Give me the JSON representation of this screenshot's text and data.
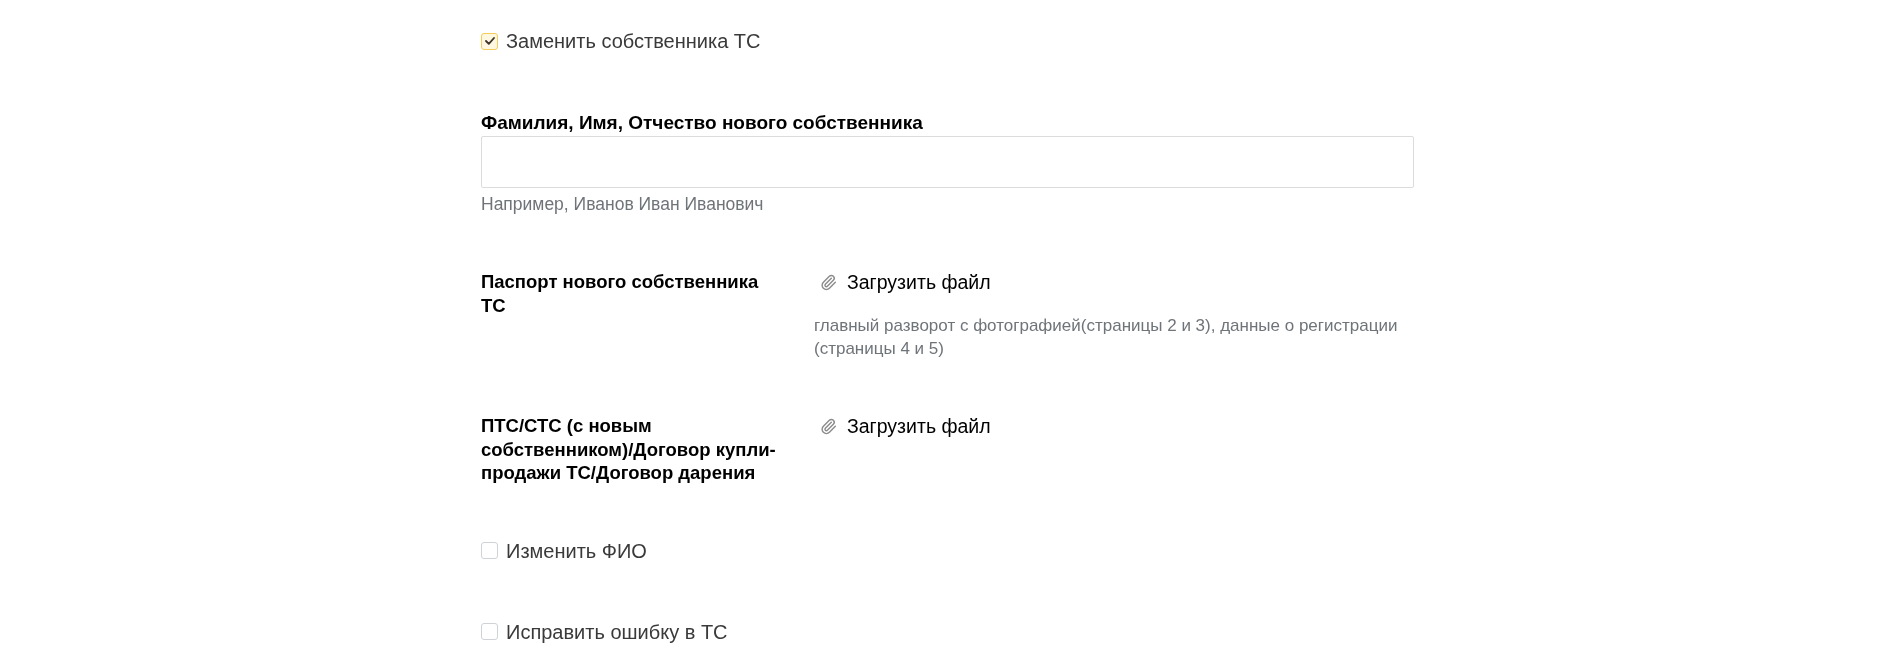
{
  "form": [
    {
      "kind": "checkbox",
      "label": "Заменить собственника ТС",
      "checked": true
    },
    {
      "kind": "text_input",
      "label": "Фамилия, Имя, Отчество нового собственника",
      "help_text": "Например, Иванов Иван Иванович"
    },
    {
      "kind": "file_upload",
      "label": "Паспорт нового собственника ТС",
      "button": "Загрузить файл",
      "help_text": "главный разворот с фотографией(страницы 2 и 3), данные о регистрации (страницы 4 и 5)"
    },
    {
      "kind": "file_upload",
      "label": "ПТС/СТС (с новым собственником)/Договор купли-продажи ТС/Договор дарения",
      "button": "Загрузить файл"
    },
    {
      "kind": "checkbox",
      "label": "Изменить ФИО",
      "checked": false
    },
    {
      "kind": "checkbox",
      "label": "Исправить ошибку в ТС",
      "checked": false
    }
  ]
}
